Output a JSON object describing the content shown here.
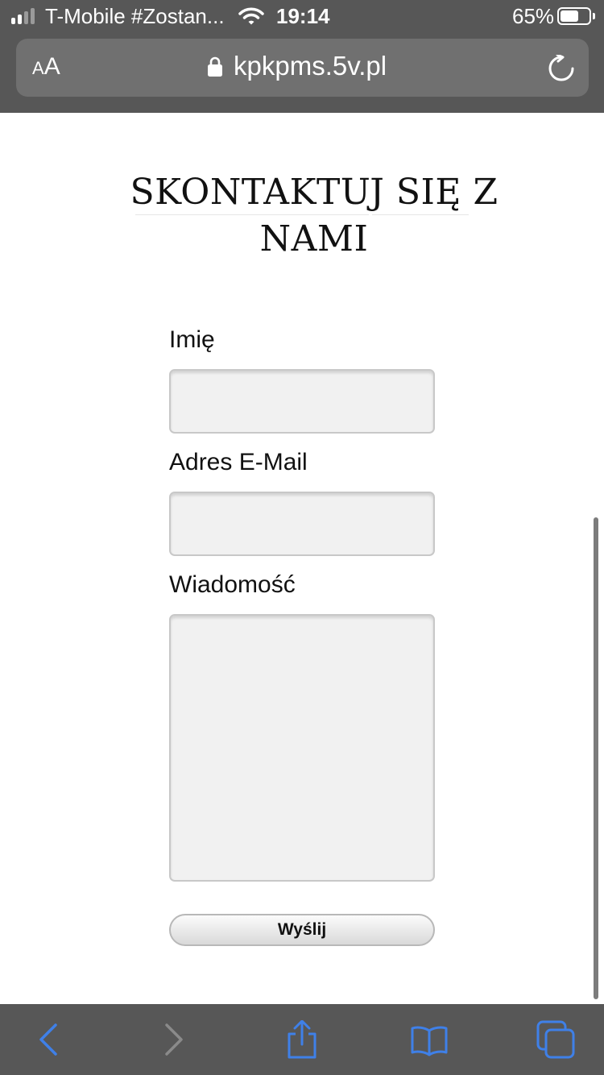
{
  "status_bar": {
    "carrier": "T-Mobile #Zostan...",
    "time": "19:14",
    "battery_percent": "65%",
    "battery_level": 0.65,
    "signal_bars_filled": 2,
    "signal_bars_total": 4
  },
  "browser": {
    "text_size_label_small": "A",
    "text_size_label_large": "A",
    "url": "kpkpms.5v.pl"
  },
  "page": {
    "title_line1": "SKONTAKTUJ SIĘ Z",
    "title_line2": "NAMI",
    "form": {
      "name_label": "Imię",
      "name_value": "",
      "email_label": "Adres E-Mail",
      "email_value": "",
      "message_label": "Wiadomość",
      "message_value": "",
      "submit_label": "Wyślij"
    }
  },
  "toolbar": {
    "icons": [
      "back-icon",
      "forward-icon",
      "share-icon",
      "bookmarks-icon",
      "tabs-icon"
    ]
  },
  "colors": {
    "chrome": "#575757",
    "url_field": "#707070",
    "accent": "#3f80e8",
    "disabled": "#8a8a8a",
    "input_bg": "#f1f1f1"
  }
}
